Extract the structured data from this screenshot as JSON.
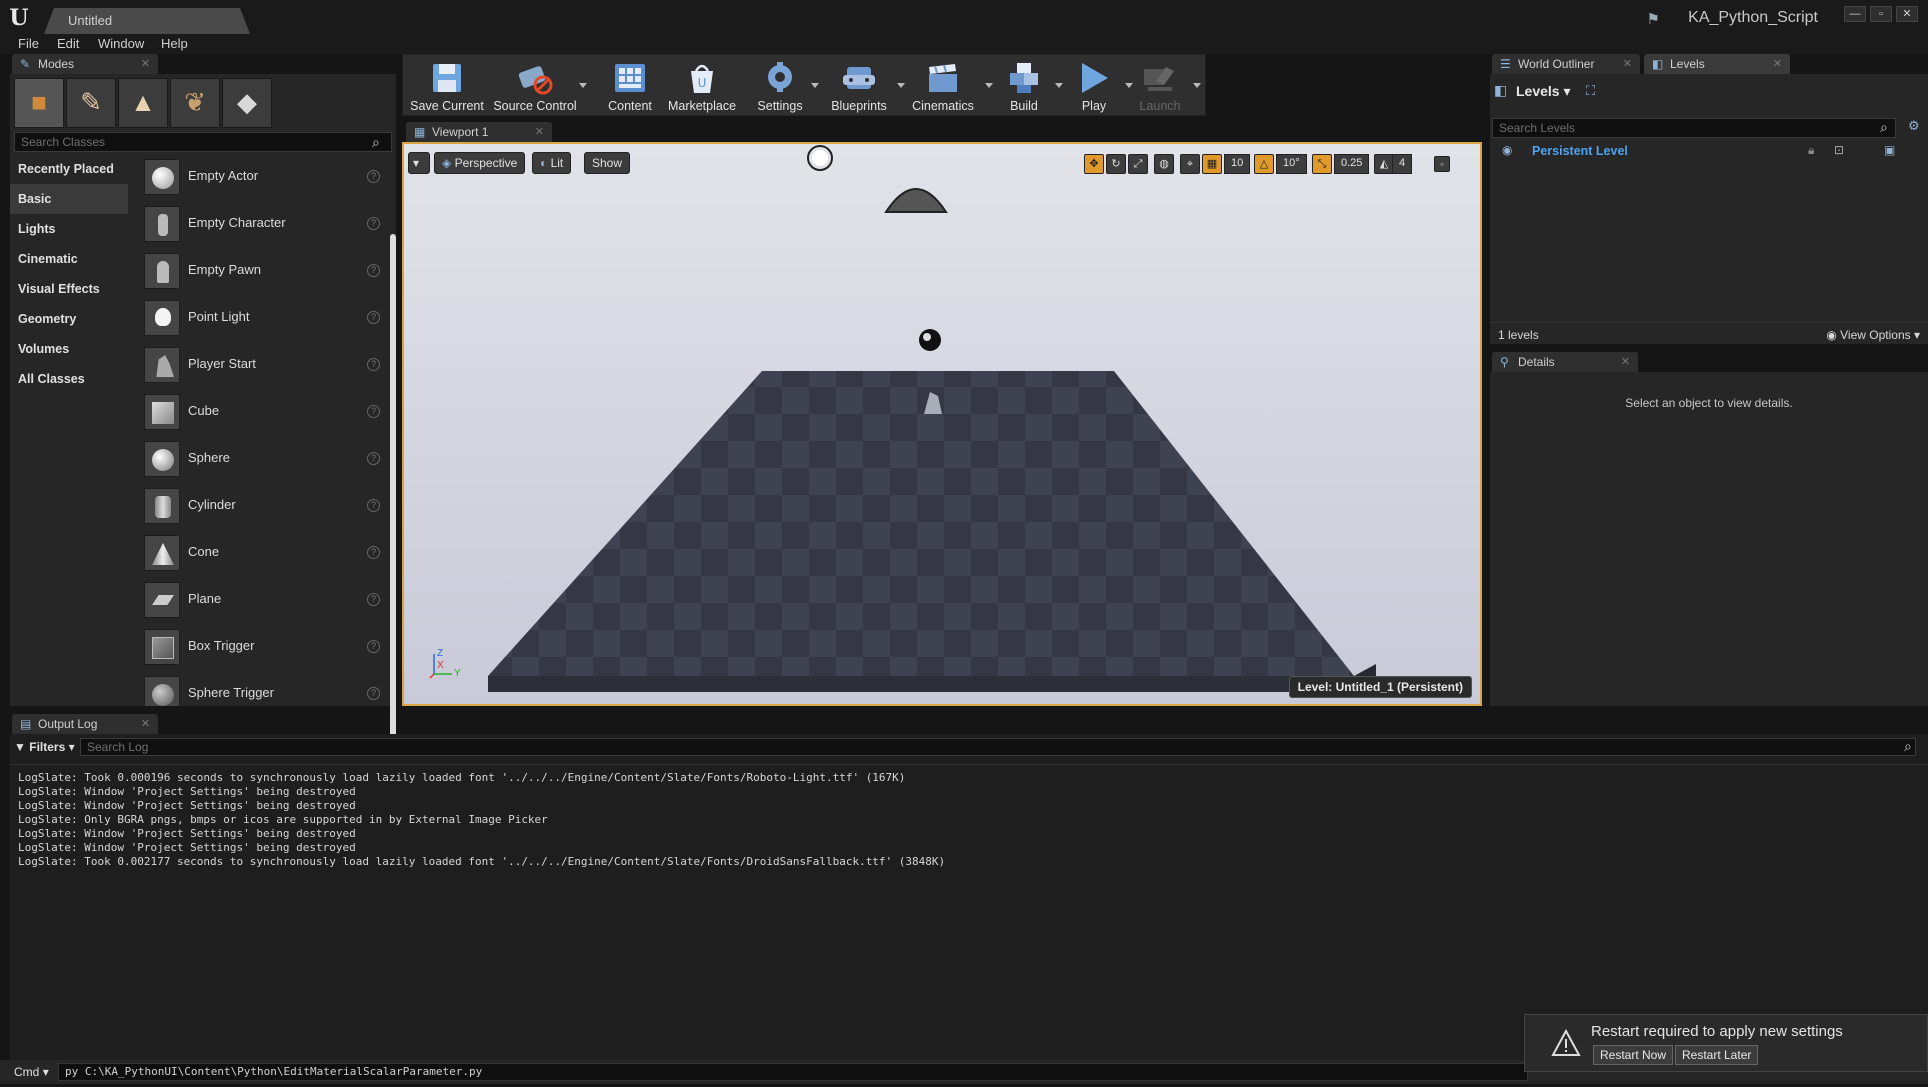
{
  "window": {
    "doc_tab": "Untitled",
    "project": "KA_Python_Script",
    "controls": [
      "—",
      "▫",
      "✕"
    ]
  },
  "menu": [
    "File",
    "Edit",
    "Window",
    "Help"
  ],
  "modes": {
    "tab": "Modes",
    "search_placeholder": "Search Classes",
    "categories": [
      "Recently Placed",
      "Basic",
      "Lights",
      "Cinematic",
      "Visual Effects",
      "Geometry",
      "Volumes",
      "All Classes"
    ],
    "actors": [
      "Empty Actor",
      "Empty Character",
      "Empty Pawn",
      "Point Light",
      "Player Start",
      "Cube",
      "Sphere",
      "Cylinder",
      "Cone",
      "Plane",
      "Box Trigger",
      "Sphere Trigger"
    ]
  },
  "toolbar": {
    "buttons": [
      "Save Current",
      "Source Control",
      "Content",
      "Marketplace",
      "Settings",
      "Blueprints",
      "Cinematics",
      "Build",
      "Play",
      "Launch"
    ]
  },
  "viewport": {
    "tab": "Viewport 1",
    "perspective": "Perspective",
    "lit": "Lit",
    "show": "Show",
    "grid_snap": "10",
    "rot_snap": "10°",
    "scale_snap": "0.25",
    "cam_speed": "4",
    "level_label": "Level:  Untitled_1 (Persistent)",
    "axis": {
      "z": "Z",
      "x": "X",
      "y": "Y"
    }
  },
  "outliner_tab": "World Outliner",
  "levels": {
    "tab": "Levels",
    "header": "Levels",
    "search_placeholder": "Search Levels",
    "persistent": "Persistent Level",
    "count": "1 levels",
    "view_options": "View Options"
  },
  "details": {
    "tab": "Details",
    "empty": "Select an object to view details."
  },
  "output_log": {
    "tab": "Output Log",
    "filters": "Filters",
    "search_placeholder": "Search Log",
    "lines": [
      "LogSlate: Took 0.000196 seconds to synchronously load lazily loaded font '../../../Engine/Content/Slate/Fonts/Roboto-Light.ttf' (167K)",
      "LogSlate: Window 'Project Settings' being destroyed",
      "LogSlate: Window 'Project Settings' being destroyed",
      "LogSlate: Only BGRA pngs, bmps or icos are supported in by External Image Picker",
      "LogSlate: Window 'Project Settings' being destroyed",
      "LogSlate: Window 'Project Settings' being destroyed",
      "LogSlate: Took 0.002177 seconds to synchronously load lazily loaded font '../../../Engine/Content/Slate/Fonts/DroidSansFallback.ttf' (3848K)"
    ]
  },
  "cmd": {
    "label": "Cmd",
    "value": "py C:\\KA_PythonUI\\Content\\Python\\EditMaterialScalarParameter.py"
  },
  "notification": {
    "message": "Restart required to apply new settings",
    "restart_now": "Restart Now",
    "restart_later": "Restart Later"
  },
  "colors": {
    "accent": "#d9a443",
    "level_link": "#4ea3ee"
  }
}
